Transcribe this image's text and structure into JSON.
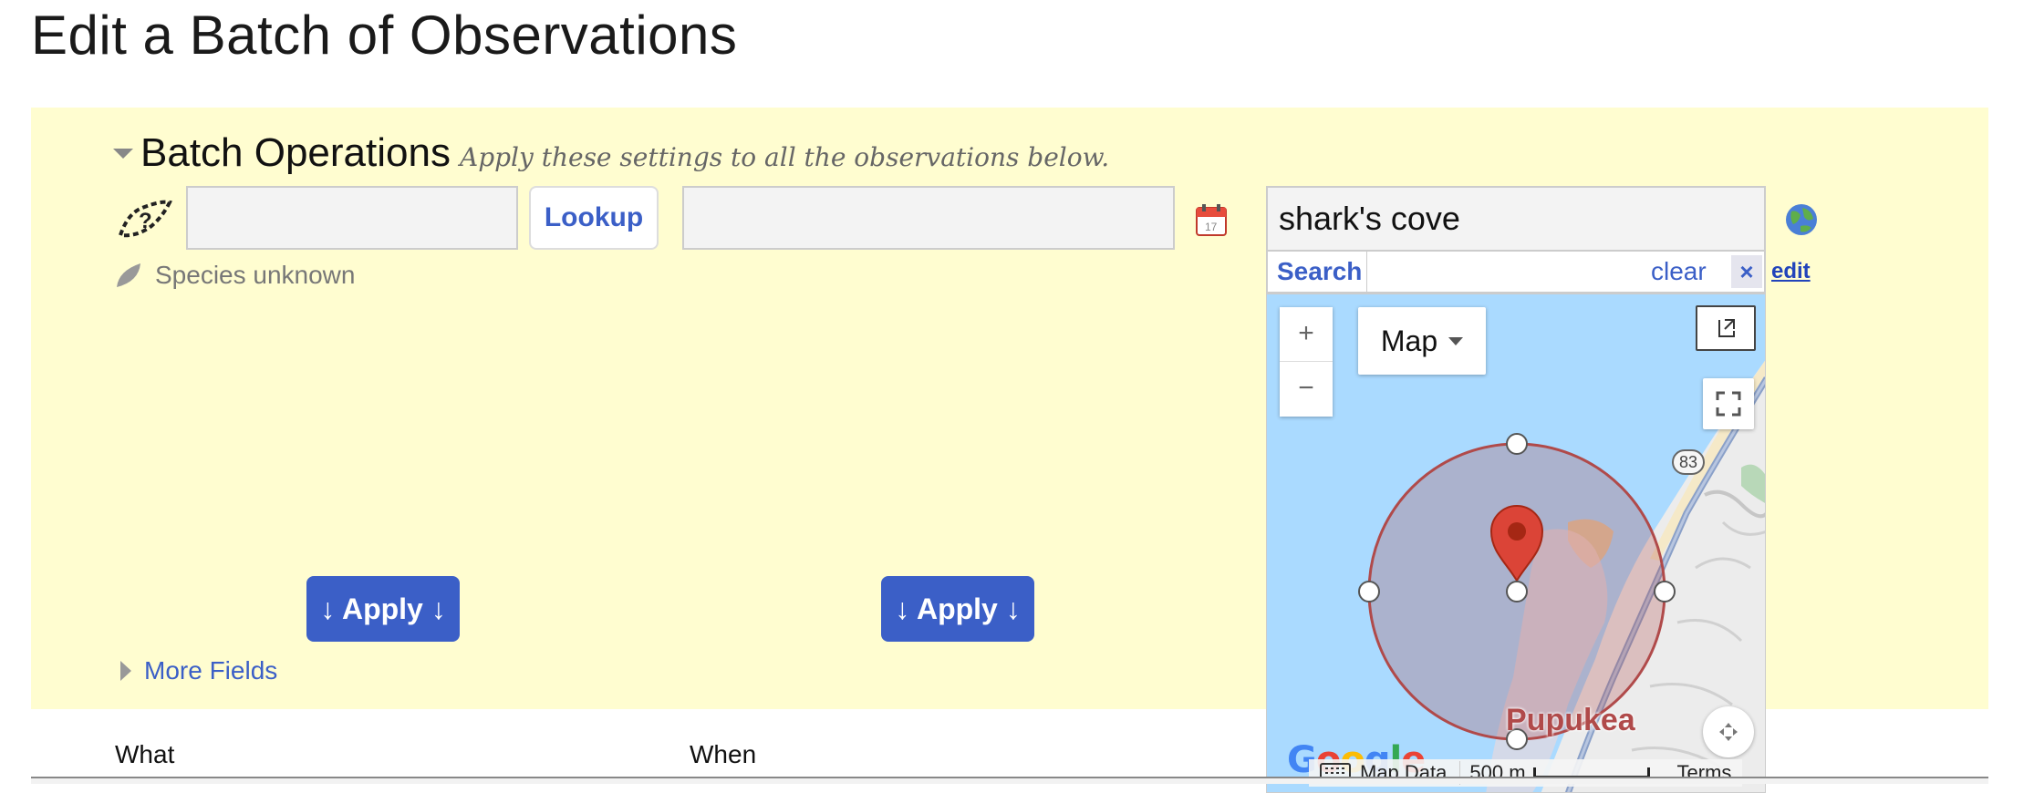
{
  "page": {
    "title": "Edit a Batch of Observations"
  },
  "batch": {
    "title": "Batch Operations",
    "hint": "Apply these settings to all the observations below.",
    "species": {
      "value": "",
      "lookup_label": "Lookup",
      "status": "Species unknown"
    },
    "date": {
      "value": ""
    },
    "apply_label": "↓ Apply ↓",
    "more_fields_label": "More Fields",
    "location": {
      "value": "shark's cove",
      "search_label": "Search",
      "clear_label": "clear",
      "close_label": "×",
      "edit_label": "edit"
    }
  },
  "map": {
    "zoom_in": "+",
    "zoom_out": "−",
    "type_label": "Map",
    "place_label": "Pupukea",
    "route_number": "83",
    "google": "Google",
    "footer": {
      "data_label": "Map Data",
      "scale_label": "500 m",
      "terms_label": "Terms"
    }
  },
  "table": {
    "columns": [
      "What",
      "When"
    ]
  },
  "colors": {
    "accent": "#3b5fc7",
    "panel": "#fffdd0",
    "circle": "#b04a4a",
    "marker": "#db4437"
  }
}
